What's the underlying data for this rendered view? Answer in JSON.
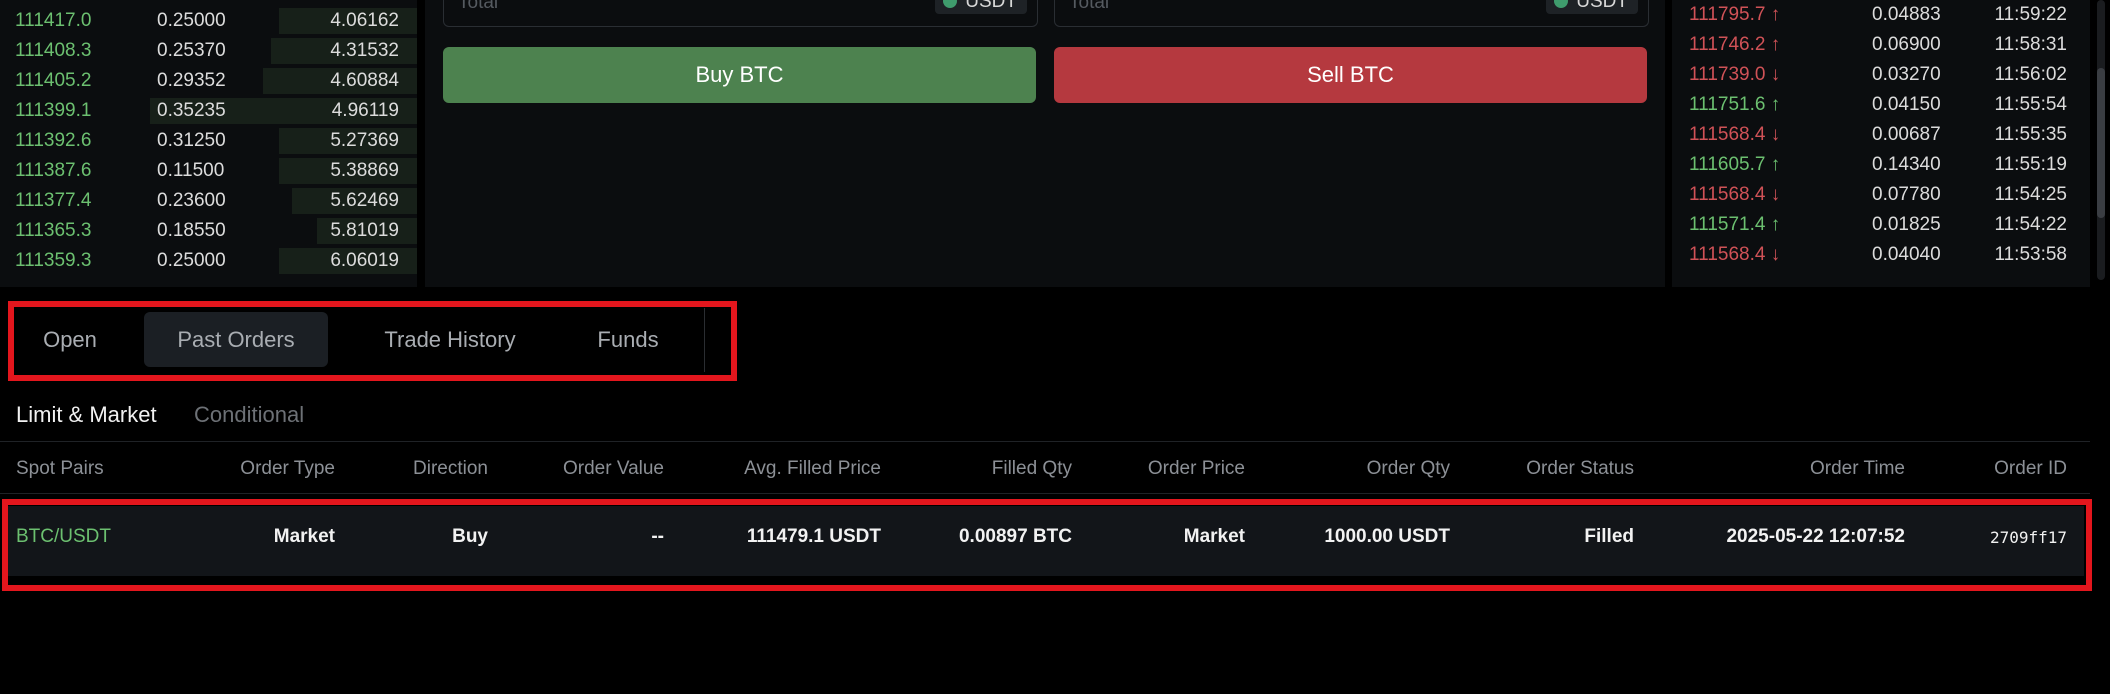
{
  "orderbook": {
    "rows": [
      {
        "price": "111417.0",
        "qty": "0.25000",
        "total": "4.06162",
        "depth": 0.33
      },
      {
        "price": "111408.3",
        "qty": "0.25370",
        "total": "4.31532",
        "depth": 0.35
      },
      {
        "price": "111405.2",
        "qty": "0.29352",
        "total": "4.60884",
        "depth": 0.37
      },
      {
        "price": "111399.1",
        "qty": "0.35235",
        "total": "4.96119",
        "depth": 0.64
      },
      {
        "price": "111392.6",
        "qty": "0.31250",
        "total": "5.27369",
        "depth": 0.33
      },
      {
        "price": "111387.6",
        "qty": "0.11500",
        "total": "5.38869",
        "depth": 0.33
      },
      {
        "price": "111377.4",
        "qty": "0.23600",
        "total": "5.62469",
        "depth": 0.3
      },
      {
        "price": "111365.3",
        "qty": "0.18550",
        "total": "5.81019",
        "depth": 0.24
      },
      {
        "price": "111359.3",
        "qty": "0.25000",
        "total": "6.06019",
        "depth": 0.33
      }
    ]
  },
  "trade_panel": {
    "buy_total_label": "Total",
    "buy_total_unit": "USDT",
    "sell_total_label": "Total",
    "sell_total_unit": "USDT",
    "buy_label": "Buy BTC",
    "sell_label": "Sell BTC"
  },
  "recent_trades": {
    "rows": [
      {
        "price": "111795.7",
        "dir": "up",
        "qty": "0.04883",
        "time": "11:59:22",
        "price_color": "#d05257"
      },
      {
        "price": "111746.2",
        "dir": "up",
        "qty": "0.06900",
        "time": "11:58:31",
        "price_color": "#d05257"
      },
      {
        "price": "111739.0",
        "dir": "down",
        "qty": "0.03270",
        "time": "11:56:02",
        "price_color": "#d05257"
      },
      {
        "price": "111751.6",
        "dir": "up",
        "qty": "0.04150",
        "time": "11:55:54",
        "price_color": "#6cc070"
      },
      {
        "price": "111568.4",
        "dir": "down",
        "qty": "0.00687",
        "time": "11:55:35",
        "price_color": "#d05257"
      },
      {
        "price": "111605.7",
        "dir": "up",
        "qty": "0.14340",
        "time": "11:55:19",
        "price_color": "#6cc070"
      },
      {
        "price": "111568.4",
        "dir": "down",
        "qty": "0.07780",
        "time": "11:54:25",
        "price_color": "#d05257"
      },
      {
        "price": "111571.4",
        "dir": "up",
        "qty": "0.01825",
        "time": "11:54:22",
        "price_color": "#6cc070"
      },
      {
        "price": "111568.4",
        "dir": "down",
        "qty": "0.04040",
        "time": "11:53:58",
        "price_color": "#d05257"
      }
    ]
  },
  "tabs": [
    {
      "label": "Open",
      "active": false
    },
    {
      "label": "Past Orders",
      "active": true
    },
    {
      "label": "Trade History",
      "active": false
    },
    {
      "label": "Funds",
      "active": false
    }
  ],
  "subtabs": {
    "limit_market": "Limit & Market",
    "conditional": "Conditional"
  },
  "orders_table": {
    "headers": {
      "spot_pairs": "Spot Pairs",
      "order_type": "Order Type",
      "direction": "Direction",
      "order_value": "Order Value",
      "avg_filled_price": "Avg. Filled Price",
      "filled_qty": "Filled Qty",
      "order_price": "Order Price",
      "order_qty": "Order Qty",
      "order_status": "Order Status",
      "order_time": "Order Time",
      "order_id": "Order ID"
    },
    "rows": [
      {
        "spot_pair": "BTC/USDT",
        "order_type": "Market",
        "direction": "Buy",
        "order_value": "--",
        "avg_filled_price": "111479.1 USDT",
        "filled_qty": "0.00897 BTC",
        "order_price": "Market",
        "order_qty": "1000.00 USDT",
        "order_status": "Filled",
        "order_time": "2025-05-22 12:07:52",
        "order_id": "2709ff17"
      }
    ]
  },
  "colors": {
    "buy_green": "#4d824f",
    "sell_red": "#b5393f",
    "up_green": "#6cc070",
    "down_red": "#d05257",
    "highlight_red": "#e3161d"
  }
}
